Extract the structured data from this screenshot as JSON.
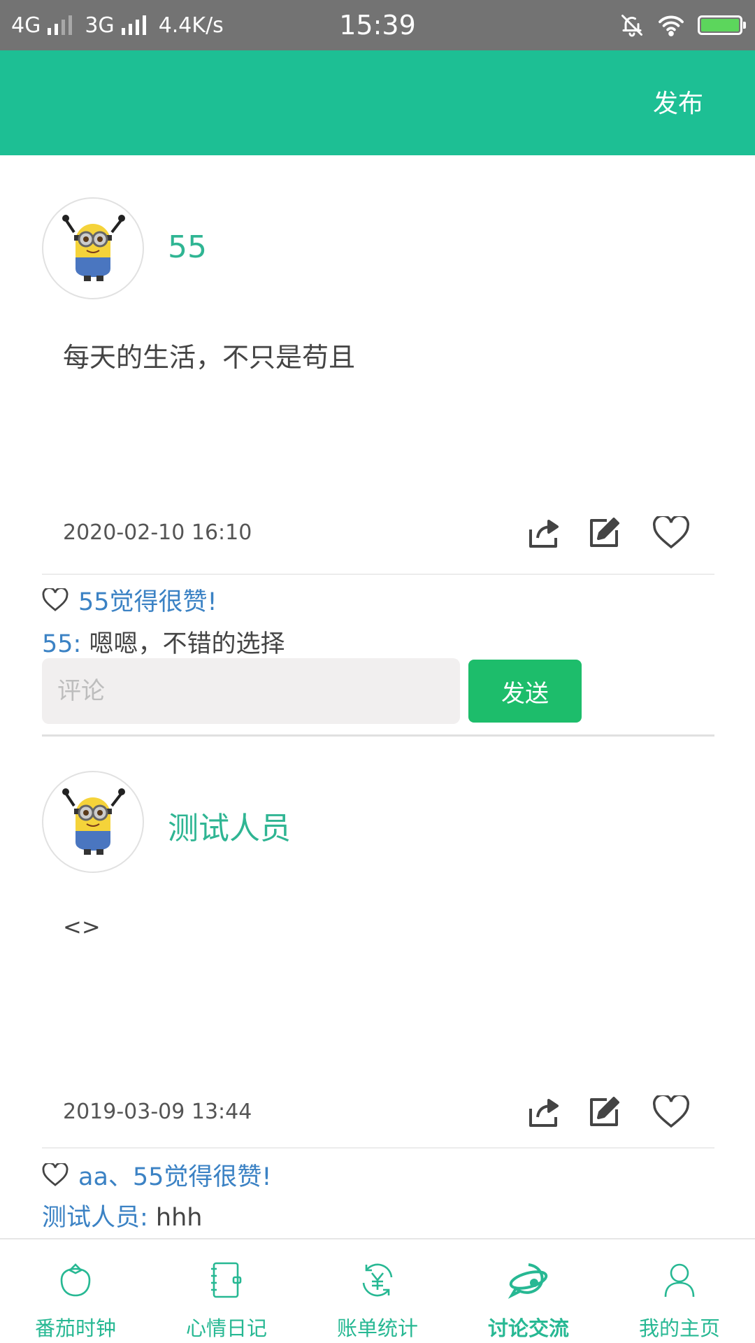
{
  "status_bar": {
    "network1": "4G",
    "network2": "3G",
    "speed": "4.4K/s",
    "time": "15:39",
    "icons": [
      "bell-mute-icon",
      "wifi-icon",
      "battery-charging-icon"
    ]
  },
  "header": {
    "publish_label": "发布",
    "color": "#1dbf94"
  },
  "posts": [
    {
      "username": "55",
      "content": "每天的生活，不只是苟且",
      "datetime": "2020-02-10 16:10",
      "likes_text": "55觉得很赞!",
      "comments": [
        {
          "author": "55:",
          "text": " 嗯嗯，不错的选择"
        }
      ],
      "comment_placeholder": "评论",
      "send_label": "发送"
    },
    {
      "username": "测试人员",
      "content": "<>",
      "datetime": "2019-03-09 13:44",
      "likes_text": "aa、55觉得很赞!",
      "comments": [
        {
          "author": "测试人员:",
          "text": " hhh"
        }
      ]
    }
  ],
  "tabs": [
    {
      "label": "番茄时钟",
      "icon": "tomato-icon",
      "active": false
    },
    {
      "label": "心情日记",
      "icon": "notebook-icon",
      "active": false
    },
    {
      "label": "账单统计",
      "icon": "yuan-refresh-icon",
      "active": false
    },
    {
      "label": "讨论交流",
      "icon": "chat-bubble-icon",
      "active": true
    },
    {
      "label": "我的主页",
      "icon": "person-icon",
      "active": false
    }
  ],
  "colors": {
    "accent": "#1dbf94",
    "send_button": "#1dbd6b",
    "link_blue": "#3b82c4"
  }
}
